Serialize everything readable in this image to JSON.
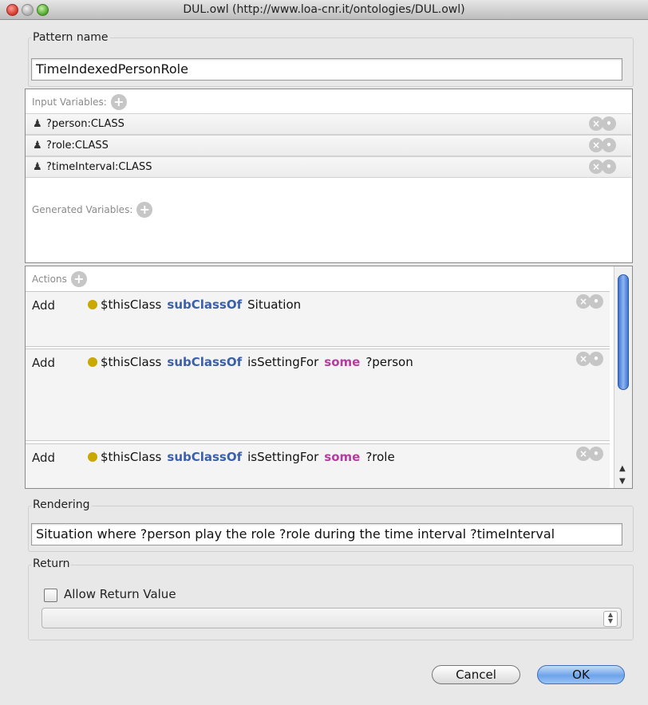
{
  "window": {
    "title": "DUL.owl (http://www.loa-cnr.it/ontologies/DUL.owl)"
  },
  "pattern_name": {
    "label": "Pattern name",
    "value": "TimeIndexedPersonRole"
  },
  "input_variables": {
    "label": "Input Variables:",
    "items": [
      {
        "text": "?person:CLASS"
      },
      {
        "text": "?role:CLASS"
      },
      {
        "text": "?timeInterval:CLASS"
      }
    ]
  },
  "generated_variables": {
    "label": "Generated Variables:"
  },
  "actions": {
    "label": "Actions",
    "items": [
      {
        "verb": "Add",
        "subject": "$thisClass",
        "op": "subClassOf",
        "rest": "Situation",
        "quant": "",
        "var": ""
      },
      {
        "verb": "Add",
        "subject": "$thisClass",
        "op": "subClassOf",
        "rest": "isSettingFor",
        "quant": "some",
        "var": "?person"
      },
      {
        "verb": "Add",
        "subject": "$thisClass",
        "op": "subClassOf",
        "rest": "isSettingFor",
        "quant": "some",
        "var": "?role"
      }
    ]
  },
  "rendering": {
    "label": "Rendering",
    "value": "Situation where ?person play the role ?role during the time interval ?timeInterval"
  },
  "return": {
    "label": "Return",
    "checkbox_label": "Allow Return Value",
    "checked": false,
    "select_value": ""
  },
  "buttons": {
    "cancel": "Cancel",
    "ok": "OK"
  },
  "colors": {
    "keyword_blue": "#3b5fa8",
    "keyword_pink": "#b53ca0",
    "dot": "#c9a800",
    "ok_button": "#6da4ea"
  }
}
